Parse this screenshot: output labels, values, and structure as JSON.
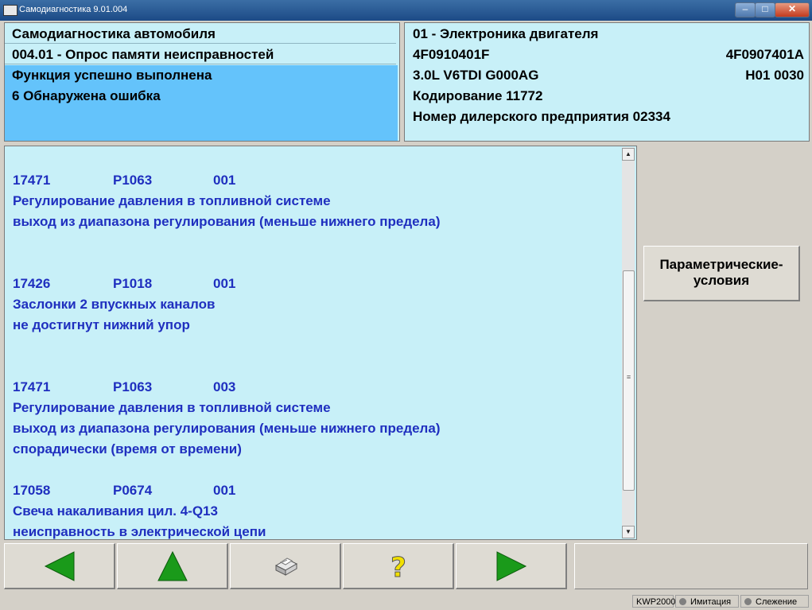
{
  "window": {
    "title": "Самодиагностика 9.01.004"
  },
  "left_panel": {
    "title": "Самодиагностика автомобиля",
    "function": "004.01 - Опрос памяти неисправностей",
    "status_line1": "Функция успешно выполнена",
    "status_line2": "6 Обнаружена ошибка"
  },
  "right_panel": {
    "module": "01 - Электроника двигателя",
    "part_no": "4F0910401F",
    "part_no_right": "4F0907401A",
    "engine": "3.0L V6TDI  G000AG",
    "engine_right": "H01  0030",
    "coding": "Кодирование 11772",
    "dealer": "Номер дилерского предприятия 02334"
  },
  "faults": [
    {
      "code": "17471",
      "pcode": "P1063",
      "count": "001",
      "lines": [
        "Регулирование давления в топливной системе",
        "выход из диапазона регулирования (меньше нижнего предела)"
      ]
    },
    {
      "code": "17426",
      "pcode": "P1018",
      "count": "001",
      "lines": [
        "Заслонки 2 впускных каналов",
        "не достигнут нижний упор"
      ]
    },
    {
      "code": "17471",
      "pcode": "P1063",
      "count": "003",
      "lines": [
        "Регулирование давления в топливной системе",
        "выход из диапазона регулирования (меньше нижнего предела)",
        "спорадически (время от времени)"
      ]
    },
    {
      "code": "17058",
      "pcode": "P0674",
      "count": "001",
      "lines": [
        "Свеча накаливания цил. 4-Q13",
        "неисправность в электрической цепи"
      ]
    }
  ],
  "side": {
    "param_button_line1": "Параметрические-",
    "param_button_line2": "условия"
  },
  "toolbar": {
    "back_icon": "arrow-left-icon",
    "up_icon": "arrow-up-icon",
    "print_icon": "printer-icon",
    "help_icon": "question-icon",
    "next_icon": "arrow-right-icon",
    "arrow_color": "#1a9a1a",
    "help_color": "#f2e000"
  },
  "status": {
    "protocol": "KWP2000",
    "simulation": "Имитация",
    "tracking": "Слежение"
  },
  "colors": {
    "panel_bg": "#c8f0f8",
    "highlight_bg": "#64c3fb",
    "fault_text": "#1f2fbf"
  }
}
